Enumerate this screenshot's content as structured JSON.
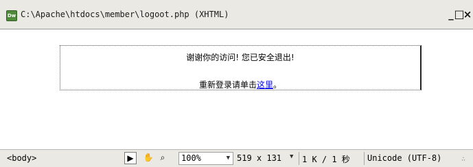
{
  "window": {
    "app_icon": "Dw",
    "title": "C:\\Apache\\htdocs\\member\\logoot.php (XHTML)",
    "minimize_label": "_",
    "maximize_label": "□",
    "close_label": "×"
  },
  "content": {
    "line1": "谢谢你的访问! 您已安全退出!",
    "line2_prefix": "重新登录请单击",
    "line2_link": "这里",
    "line2_suffix": "。"
  },
  "statusbar": {
    "tag_selector": "<body>",
    "select_tool_icon": "arrow-pointer-icon",
    "hand_tool_icon": "hand-icon",
    "zoom_tool_icon": "magnifier-icon",
    "zoom_value": "100%",
    "window_size": "519 x 131",
    "download_info": "1 K / 1 秒",
    "encoding": "Unicode (UTF-8)"
  }
}
